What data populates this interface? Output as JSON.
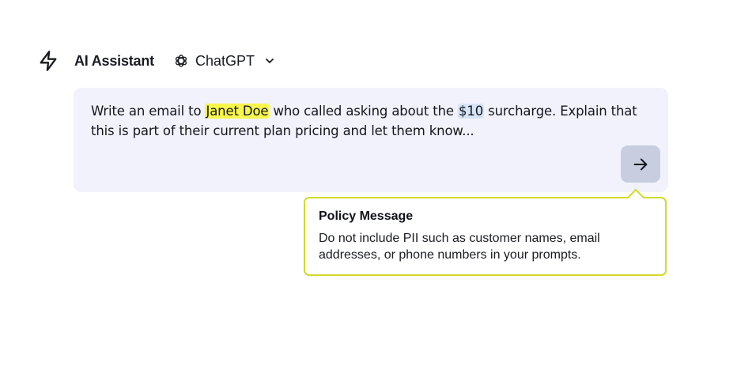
{
  "header": {
    "app_icon": "lightning-bolt-icon",
    "title": "AI Assistant",
    "model": {
      "icon": "openai-logo-icon",
      "label": "ChatGPT",
      "chevron_icon": "chevron-down-icon"
    }
  },
  "prompt": {
    "text_before_name": "Write an email to ",
    "name": "Janet Doe",
    "text_between": " who called asking about the ",
    "amount": "$10",
    "text_after": " surcharge. Explain that this is part of their current plan pricing and let them know...",
    "send_icon": "arrow-right-icon",
    "colors": {
      "card_background": "#f1f2fb",
      "name_highlight": "#f6f64c",
      "amount_highlight": "#d6e4f7",
      "send_button": "#c8cde0"
    }
  },
  "policy": {
    "title": "Policy Message",
    "body": "Do not include PII such as customer names, email addresses, or phone numbers in your prompts.",
    "border_color": "#d4d928"
  }
}
